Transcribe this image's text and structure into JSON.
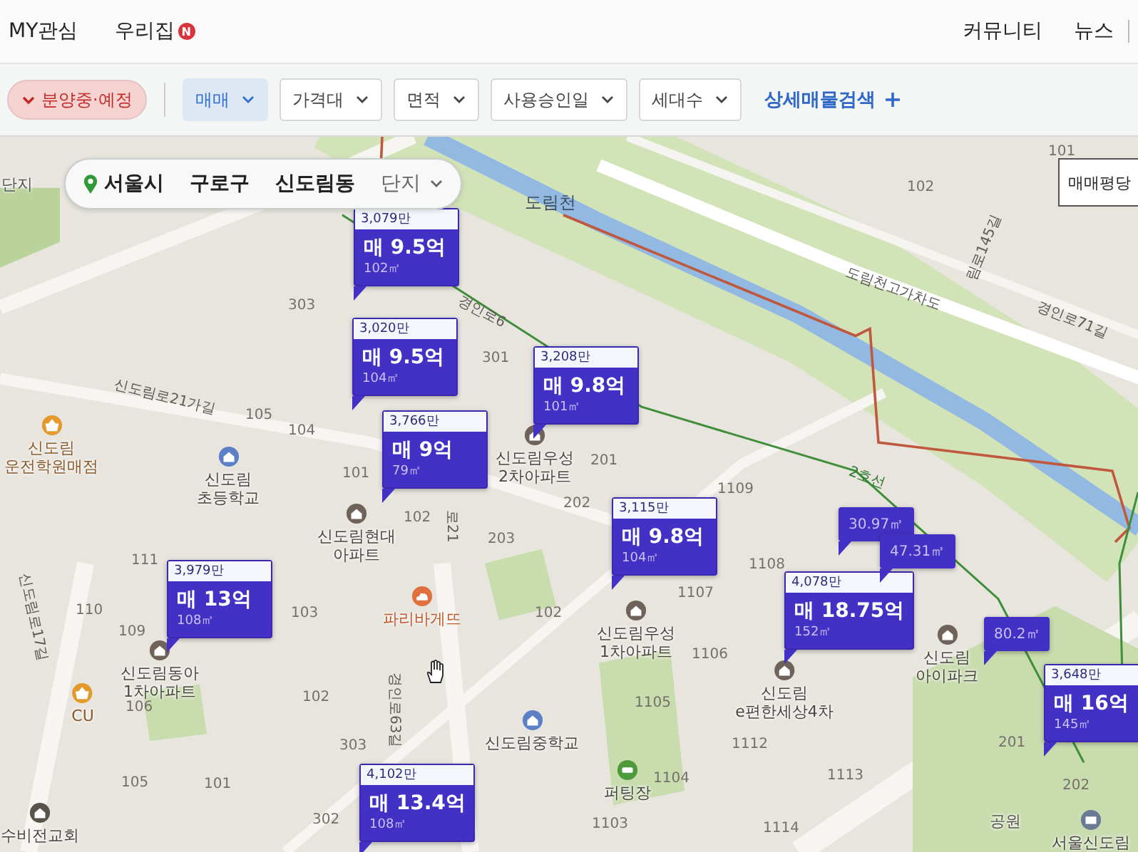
{
  "top_nav": {
    "left": [
      {
        "label": "MY관심"
      },
      {
        "label": "우리집",
        "badge": "N"
      }
    ],
    "right": [
      {
        "label": "커뮤니티"
      },
      {
        "label": "뉴스"
      }
    ]
  },
  "filters": [
    {
      "label": "분양중·예정",
      "kind": "toggle",
      "checked": true
    },
    {
      "label": "매매",
      "kind": "dropdown",
      "selected": true
    },
    {
      "label": "가격대",
      "kind": "dropdown",
      "selected": false
    },
    {
      "label": "면적",
      "kind": "dropdown",
      "selected": false
    },
    {
      "label": "사용승인일",
      "kind": "dropdown",
      "selected": false
    },
    {
      "label": "세대수",
      "kind": "dropdown",
      "selected": false
    }
  ],
  "detail_search": "상세매물검색",
  "breadcrumb": {
    "items": [
      "서울시",
      "구로구",
      "신도림동"
    ],
    "dropdown": "단지"
  },
  "legend_button": "매매평당",
  "map": {
    "price_markers": [
      {
        "unit_price": "3,079만",
        "price": "매 9.5억",
        "area": "102㎡"
      },
      {
        "unit_price": "3,020만",
        "price": "매 9.5억",
        "area": "104㎡"
      },
      {
        "unit_price": "3,766만",
        "price": "매 9억",
        "area": "79㎡"
      },
      {
        "unit_price": "3,208만",
        "price": "매 9.8억",
        "area": "101㎡"
      },
      {
        "unit_price": "3,115만",
        "price": "매 9.8억",
        "area": "104㎡"
      },
      {
        "unit_price": "4,078만",
        "price": "매 18.75억",
        "area": "152㎡"
      },
      {
        "unit_price": "3,979만",
        "price": "매 13억",
        "area": "108㎡"
      },
      {
        "unit_price": "4,102만",
        "price": "매 13.4억",
        "area": "108㎡"
      },
      {
        "unit_price": "3,648만",
        "price": "매 16억",
        "area": "145㎡"
      }
    ],
    "area_markers": [
      "30.97㎡",
      "47.31㎡",
      "80.2㎡"
    ],
    "places": [
      {
        "lines": [
          "단지"
        ],
        "kind": "none"
      },
      {
        "lines": [
          "신도림",
          "운전학원매점"
        ],
        "kind": "shop"
      },
      {
        "lines": [
          "신도림",
          "초등학교"
        ],
        "kind": "school"
      },
      {
        "lines": [
          "신도림현대",
          "아파트"
        ],
        "kind": "apartment"
      },
      {
        "lines": [
          "신도림우성",
          "2차아파트"
        ],
        "kind": "apartment"
      },
      {
        "lines": [
          "파리바게뜨"
        ],
        "kind": "bakery"
      },
      {
        "lines": [
          "신도림동아",
          "1차아파트"
        ],
        "kind": "apartment"
      },
      {
        "lines": [
          "CU"
        ],
        "kind": "shop"
      },
      {
        "lines": [
          "수비전교회"
        ],
        "kind": "church"
      },
      {
        "lines": [
          "신도림중학교"
        ],
        "kind": "school"
      },
      {
        "lines": [
          "신도림우성",
          "1차아파트"
        ],
        "kind": "apartment"
      },
      {
        "lines": [
          "신도림",
          "e편한세상4차"
        ],
        "kind": "apartment"
      },
      {
        "lines": [
          "신도림",
          "아이파크"
        ],
        "kind": "apartment"
      },
      {
        "lines": [
          "퍼팅장"
        ],
        "kind": "putting"
      },
      {
        "lines": [
          "공원"
        ],
        "kind": "none"
      },
      {
        "lines": [
          "서울신도림"
        ],
        "kind": "post"
      }
    ],
    "building_numbers": [
      "102",
      "101",
      "303",
      "301",
      "105",
      "104",
      "101",
      "102",
      "203",
      "202",
      "201",
      "1109",
      "1108",
      "1107",
      "1106",
      "1105",
      "1104",
      "1103",
      "1112",
      "1113",
      "1114",
      "111",
      "110",
      "109",
      "106",
      "105",
      "101",
      "103",
      "102",
      "303",
      "302",
      "102",
      "201",
      "202"
    ],
    "road_labels": [
      {
        "text": "도림천",
        "kind": "water"
      },
      {
        "text": "신도림로21가길",
        "kind": "road"
      },
      {
        "text": "경인로6",
        "kind": "road"
      },
      {
        "text": "도림천고가차도",
        "kind": "road"
      },
      {
        "text": "경인로71길",
        "kind": "road"
      },
      {
        "text": "2호선",
        "kind": "subway"
      },
      {
        "text": "신도림로17길",
        "kind": "road"
      },
      {
        "text": "경인로63길",
        "kind": "road"
      },
      {
        "text": "로21",
        "kind": "road"
      },
      {
        "text": "림로145길",
        "kind": "road"
      }
    ]
  }
}
